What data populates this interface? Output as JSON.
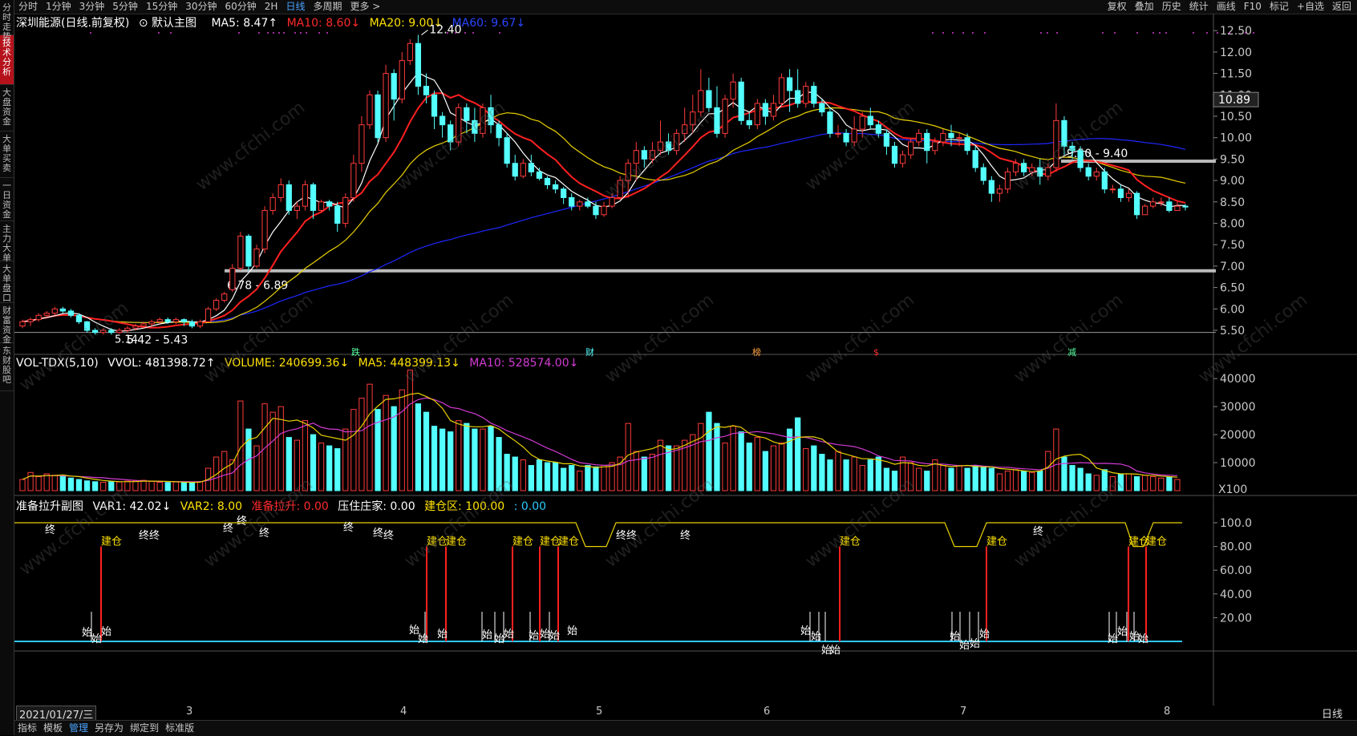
{
  "sidebar": [
    "分时走势",
    "技术分析",
    "大盘资金",
    "大单买卖",
    "一日资金",
    "主力大单",
    "大单盘口",
    "财富资金",
    "东财股吧"
  ],
  "toolbar": {
    "periods": [
      "分时",
      "1分钟",
      "3分钟",
      "5分钟",
      "15分钟",
      "30分钟",
      "60分钟",
      "2H",
      "日线",
      "多周期",
      "更多 >"
    ],
    "active_period": "日线",
    "right": [
      "复权",
      "叠加",
      "历史",
      "统计",
      "画线",
      "F10",
      "标记",
      "+自选",
      "返回"
    ]
  },
  "main": {
    "stock": "深圳能源(日线.前复权)",
    "template": "默认主图",
    "ma5": "MA5: 8.47↑",
    "ma10": "MA10: 8.60↓",
    "ma20": "MA20: 9.00↓",
    "ma60": "MA60: 9.67↓",
    "price_label": "10.89",
    "y_ticks": [
      "12.50",
      "12.00",
      "11.50",
      "11.00",
      "10.50",
      "10.00",
      "9.50",
      "9.00",
      "8.50",
      "8.00",
      "7.50",
      "7.00",
      "6.50",
      "6.00",
      "5.50"
    ],
    "annot_high": "12.40",
    "annot_low": "5.42 - 5.43",
    "annot_low2": "5.14",
    "zone1": "6.78 - 6.89",
    "zone2": "9.50 - 9.40",
    "events": [
      "跌",
      "财",
      "榜",
      "$",
      "减"
    ]
  },
  "volume": {
    "title": "VOL-TDX(5,10)",
    "vvol": "VVOL: 481398.72↑",
    "volume": "VOLUME: 240699.36↓",
    "ma5": "MA5: 448399.13↓",
    "ma10": "MA10: 528574.00↓",
    "y_ticks": [
      "40000",
      "30000",
      "20000",
      "10000"
    ],
    "unit": "X100"
  },
  "indicator": {
    "title": "准备拉升副图",
    "var1": "VAR1: 42.02↓",
    "var2": "VAR2: 8.00",
    "zbls": "准备拉升: 0.00",
    "yzzj": "压住庄家: 0.00",
    "jcq": "建仓区: 100.00",
    "tail": ": 0.00",
    "y_ticks": [
      "100.0",
      "80.00",
      "60.00",
      "40.00",
      "20.00"
    ],
    "build": "建仓",
    "start": "始",
    "end": "终"
  },
  "xaxis": {
    "date": "2021/01/27/三",
    "months": [
      "3",
      "4",
      "5",
      "6",
      "7",
      "8"
    ],
    "period": "日线"
  },
  "bottom": {
    "items": [
      "指标",
      "模板",
      "管理",
      "另存为",
      "绑定到",
      "标准版"
    ],
    "active": "管理"
  },
  "watermark": "www.cfchi.com",
  "colors": {
    "up": "#ff3b3b",
    "down": "#54ffff",
    "ma5": "#ffffff",
    "ma10": "#ff2020",
    "ma20": "#e8d000",
    "ma60": "#1e28ff",
    "purple": "#d33bd3"
  },
  "chart_data": {
    "type": "candlestick",
    "candles": [
      [
        5.6,
        5.7,
        5.55,
        5.75
      ],
      [
        5.7,
        5.75,
        5.6,
        5.8
      ],
      [
        5.75,
        5.85,
        5.7,
        5.9
      ],
      [
        5.85,
        5.9,
        5.8,
        5.95
      ],
      [
        5.9,
        6.0,
        5.85,
        6.05
      ],
      [
        6.0,
        5.95,
        5.9,
        6.05
      ],
      [
        5.95,
        5.85,
        5.8,
        6.0
      ],
      [
        5.85,
        5.7,
        5.65,
        5.9
      ],
      [
        5.7,
        5.5,
        5.45,
        5.72
      ],
      [
        5.5,
        5.45,
        5.4,
        5.55
      ],
      [
        5.45,
        5.5,
        5.4,
        5.55
      ],
      [
        5.5,
        5.45,
        5.4,
        5.55
      ],
      [
        5.45,
        5.5,
        5.42,
        5.55
      ],
      [
        5.5,
        5.55,
        5.45,
        5.6
      ],
      [
        5.55,
        5.6,
        5.5,
        5.65
      ],
      [
        5.6,
        5.65,
        5.55,
        5.7
      ],
      [
        5.65,
        5.7,
        5.6,
        5.75
      ],
      [
        5.7,
        5.75,
        5.65,
        5.8
      ],
      [
        5.75,
        5.7,
        5.65,
        5.8
      ],
      [
        5.7,
        5.75,
        5.65,
        5.8
      ],
      [
        5.75,
        5.7,
        5.6,
        5.78
      ],
      [
        5.7,
        5.6,
        5.55,
        5.75
      ],
      [
        5.6,
        5.7,
        5.55,
        5.75
      ],
      [
        5.7,
        6.0,
        5.68,
        6.05
      ],
      [
        6.0,
        6.2,
        5.95,
        6.25
      ],
      [
        6.2,
        6.35,
        6.15,
        6.4
      ],
      [
        6.45,
        6.95,
        6.4,
        7.05
      ],
      [
        6.95,
        7.7,
        6.9,
        7.8
      ],
      [
        7.7,
        7.0,
        6.9,
        7.75
      ],
      [
        7.0,
        7.4,
        6.95,
        7.5
      ],
      [
        7.4,
        8.3,
        7.3,
        8.4
      ],
      [
        8.3,
        8.6,
        8.2,
        8.7
      ],
      [
        8.6,
        8.9,
        8.5,
        9.05
      ],
      [
        8.9,
        8.3,
        8.2,
        9.0
      ],
      [
        8.3,
        8.4,
        8.1,
        8.5
      ],
      [
        8.4,
        8.9,
        8.3,
        9.0
      ],
      [
        8.9,
        8.3,
        8.1,
        8.95
      ],
      [
        8.3,
        8.5,
        8.25,
        8.55
      ],
      [
        8.5,
        8.4,
        8.3,
        8.55
      ],
      [
        8.4,
        8.0,
        7.8,
        8.5
      ],
      [
        8.0,
        8.6,
        7.9,
        8.7
      ],
      [
        8.6,
        9.4,
        8.5,
        9.6
      ],
      [
        9.4,
        10.3,
        9.2,
        10.5
      ],
      [
        10.3,
        11.0,
        10.2,
        11.1
      ],
      [
        11.0,
        10.0,
        9.9,
        11.1
      ],
      [
        10.0,
        11.5,
        9.9,
        11.7
      ],
      [
        11.5,
        10.9,
        10.4,
        11.6
      ],
      [
        10.9,
        11.8,
        10.8,
        12.0
      ],
      [
        11.8,
        12.2,
        11.7,
        12.3
      ],
      [
        12.2,
        11.2,
        11.0,
        12.4
      ],
      [
        11.2,
        11.0,
        10.8,
        11.5
      ],
      [
        11.0,
        10.5,
        10.2,
        11.1
      ],
      [
        10.5,
        10.3,
        10.0,
        10.6
      ],
      [
        10.3,
        9.9,
        9.7,
        10.4
      ],
      [
        9.9,
        10.7,
        9.8,
        10.8
      ],
      [
        10.7,
        10.4,
        10.1,
        10.8
      ],
      [
        10.4,
        10.1,
        9.9,
        10.7
      ],
      [
        10.1,
        10.7,
        10.0,
        10.8
      ],
      [
        10.7,
        10.3,
        10.1,
        11.0
      ],
      [
        10.3,
        10.0,
        9.8,
        10.4
      ],
      [
        10.0,
        9.4,
        9.3,
        10.1
      ],
      [
        9.4,
        9.1,
        9.0,
        9.6
      ],
      [
        9.1,
        9.4,
        9.05,
        9.5
      ],
      [
        9.4,
        9.2,
        9.1,
        9.6
      ],
      [
        9.2,
        9.05,
        9.0,
        9.3
      ],
      [
        9.05,
        8.9,
        8.8,
        9.1
      ],
      [
        8.9,
        8.8,
        8.7,
        9.0
      ],
      [
        8.8,
        8.6,
        8.45,
        8.85
      ],
      [
        8.6,
        8.4,
        8.3,
        8.7
      ],
      [
        8.4,
        8.5,
        8.3,
        8.55
      ],
      [
        8.5,
        8.4,
        8.35,
        8.6
      ],
      [
        8.4,
        8.2,
        8.1,
        8.5
      ],
      [
        8.2,
        8.4,
        8.15,
        8.5
      ],
      [
        8.4,
        8.6,
        8.35,
        8.7
      ],
      [
        8.6,
        9.0,
        8.55,
        9.1
      ],
      [
        9.0,
        9.4,
        8.6,
        9.5
      ],
      [
        9.4,
        9.7,
        9.0,
        9.9
      ],
      [
        9.7,
        9.5,
        9.3,
        9.8
      ],
      [
        9.5,
        9.7,
        9.4,
        9.9
      ],
      [
        9.7,
        9.9,
        9.6,
        10.4
      ],
      [
        9.9,
        9.7,
        9.6,
        10.1
      ],
      [
        9.7,
        10.1,
        9.6,
        10.2
      ],
      [
        10.1,
        10.3,
        9.9,
        10.7
      ],
      [
        10.3,
        10.6,
        10.1,
        11.0
      ],
      [
        10.6,
        11.1,
        10.5,
        11.6
      ],
      [
        11.1,
        10.7,
        10.6,
        11.4
      ],
      [
        10.7,
        10.1,
        10.0,
        11.2
      ],
      [
        10.1,
        10.9,
        10.0,
        11.0
      ],
      [
        10.9,
        11.3,
        10.7,
        11.5
      ],
      [
        11.3,
        10.4,
        10.3,
        11.4
      ],
      [
        10.4,
        10.3,
        10.2,
        10.6
      ],
      [
        10.3,
        10.8,
        10.2,
        10.9
      ],
      [
        10.8,
        10.5,
        10.3,
        10.9
      ],
      [
        10.5,
        10.8,
        10.4,
        11.0
      ],
      [
        10.8,
        11.4,
        10.7,
        11.5
      ],
      [
        11.4,
        11.1,
        10.6,
        11.6
      ],
      [
        11.1,
        10.8,
        10.7,
        11.6
      ],
      [
        10.8,
        11.2,
        10.7,
        11.3
      ],
      [
        11.2,
        10.8,
        10.7,
        11.3
      ],
      [
        10.8,
        10.6,
        10.5,
        10.9
      ],
      [
        10.6,
        10.1,
        10.0,
        10.7
      ],
      [
        10.1,
        10.1,
        10.0,
        10.3
      ],
      [
        10.1,
        9.9,
        9.8,
        10.2
      ],
      [
        9.9,
        10.2,
        9.8,
        10.5
      ],
      [
        10.2,
        10.5,
        10.0,
        10.6
      ],
      [
        10.5,
        10.3,
        10.2,
        10.7
      ],
      [
        10.3,
        10.1,
        10.0,
        10.4
      ],
      [
        10.1,
        9.8,
        9.6,
        10.2
      ],
      [
        9.8,
        9.4,
        9.3,
        9.9
      ],
      [
        9.4,
        9.6,
        9.3,
        9.7
      ],
      [
        9.6,
        9.9,
        9.5,
        10.0
      ],
      [
        9.9,
        10.1,
        9.8,
        10.2
      ],
      [
        10.1,
        9.7,
        9.4,
        10.2
      ],
      [
        9.7,
        9.9,
        9.6,
        10.0
      ],
      [
        9.9,
        10.1,
        9.8,
        10.2
      ],
      [
        10.1,
        10.0,
        9.8,
        10.3
      ],
      [
        10.0,
        10.0,
        9.8,
        10.1
      ],
      [
        10.0,
        9.7,
        9.6,
        10.1
      ],
      [
        9.7,
        9.3,
        9.2,
        9.8
      ],
      [
        9.3,
        9.0,
        8.9,
        9.4
      ],
      [
        9.0,
        8.7,
        8.5,
        9.1
      ],
      [
        8.7,
        8.8,
        8.5,
        8.9
      ],
      [
        8.8,
        9.2,
        8.7,
        9.3
      ],
      [
        9.2,
        9.4,
        9.1,
        9.5
      ],
      [
        9.4,
        9.2,
        9.1,
        9.5
      ],
      [
        9.2,
        9.3,
        9.1,
        9.4
      ],
      [
        9.3,
        9.1,
        8.9,
        9.5
      ],
      [
        9.1,
        9.3,
        9.0,
        9.4
      ],
      [
        9.3,
        10.4,
        9.2,
        10.8
      ],
      [
        10.4,
        9.8,
        9.6,
        10.5
      ],
      [
        9.8,
        9.7,
        9.5,
        9.9
      ],
      [
        9.7,
        9.3,
        9.2,
        9.8
      ],
      [
        9.3,
        9.1,
        9.0,
        9.4
      ],
      [
        9.1,
        9.2,
        9.0,
        9.3
      ],
      [
        9.2,
        8.8,
        8.7,
        9.3
      ],
      [
        8.8,
        8.8,
        8.7,
        8.9
      ],
      [
        8.8,
        8.6,
        8.5,
        8.9
      ],
      [
        8.6,
        8.7,
        8.5,
        8.8
      ],
      [
        8.7,
        8.2,
        8.1,
        8.75
      ],
      [
        8.2,
        8.4,
        8.2,
        8.45
      ],
      [
        8.4,
        8.5,
        8.35,
        8.6
      ],
      [
        8.5,
        8.5,
        8.4,
        8.6
      ],
      [
        8.5,
        8.3,
        8.25,
        8.6
      ],
      [
        8.3,
        8.4,
        8.3,
        8.5
      ],
      [
        8.4,
        8.38,
        8.3,
        8.45
      ]
    ]
  }
}
